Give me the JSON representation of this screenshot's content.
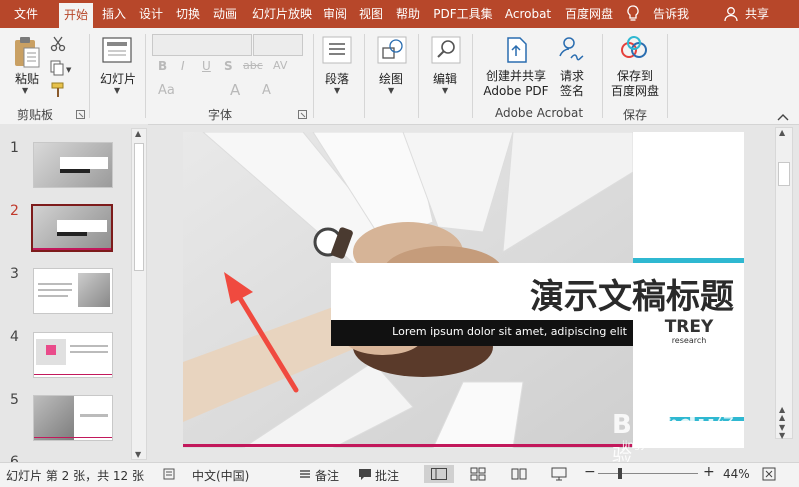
{
  "tabs": [
    {
      "label": "文件"
    },
    {
      "label": "开始"
    },
    {
      "label": "插入"
    },
    {
      "label": "设计"
    },
    {
      "label": "切换"
    },
    {
      "label": "动画"
    },
    {
      "label": "幻灯片放映"
    },
    {
      "label": "审阅"
    },
    {
      "label": "视图"
    },
    {
      "label": "帮助"
    },
    {
      "label": "PDF工具集"
    },
    {
      "label": "Acrobat"
    },
    {
      "label": "百度网盘"
    }
  ],
  "tell_me": "告诉我",
  "share": "共享",
  "ribbon": {
    "paste": "粘贴",
    "clipboard_group": "剪贴板",
    "new_slide": "幻灯片",
    "font_group": "字体",
    "paragraph": "段落",
    "drawing": "绘图",
    "editing": "编辑",
    "create_share_l1": "创建并共享",
    "create_share_l2": "Adobe PDF",
    "request_sign_l1": "请求",
    "request_sign_l2": "签名",
    "acrobat_group": "Adobe Acrobat",
    "save_to_l1": "保存到",
    "save_to_l2": "百度网盘",
    "save_group": "保存",
    "font_buttons": [
      "B",
      "I",
      "U",
      "S",
      "abc",
      "AV",
      "Aa",
      "A",
      "A"
    ]
  },
  "thumbnails": [
    {
      "num": "1"
    },
    {
      "num": "2"
    },
    {
      "num": "3"
    },
    {
      "num": "4"
    },
    {
      "num": "5"
    },
    {
      "num": "6"
    }
  ],
  "slide": {
    "title": "演示文稿标题",
    "subtitle": "Lorem ipsum dolor sit amet, adipiscing elit",
    "logo_l1": "TREY",
    "logo_l2": "research",
    "accent_color": "#2fb8d1",
    "bottom_line_color": "#c2185b",
    "arrow_color": "#f04a3f"
  },
  "status": {
    "slide_info": "幻灯片 第 2 张，共 12 张",
    "language": "中文(中国)",
    "notes": "备注",
    "comments": "批注",
    "zoom": "44%",
    "minus": "−",
    "plus": "+"
  },
  "watermark": {
    "brand": "Bai",
    "brand2": "du",
    "jingyan": "经验",
    "url": "jingyan.baidu.com"
  }
}
